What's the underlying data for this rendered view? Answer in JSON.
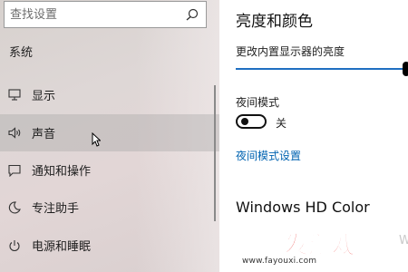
{
  "search": {
    "placeholder": "查找设置",
    "value": ""
  },
  "sidebar": {
    "section_title": "系统",
    "items": [
      {
        "label": "显示",
        "icon": "monitor-icon",
        "active": false
      },
      {
        "label": "声音",
        "icon": "speaker-icon",
        "active": true
      },
      {
        "label": "通知和操作",
        "icon": "notification-icon",
        "active": false
      },
      {
        "label": "专注助手",
        "icon": "moon-icon",
        "active": false
      },
      {
        "label": "电源和睡眠",
        "icon": "power-icon",
        "active": false
      }
    ]
  },
  "content": {
    "title": "亮度和颜色",
    "brightness_label": "更改内置显示器的亮度",
    "brightness_level_percent": 100,
    "night_mode_label": "夜间模式",
    "night_mode_state": "关",
    "night_mode_settings_link": "夜间模式设置",
    "hd_color_title": "Windows HD Color",
    "partial_text": "W"
  },
  "watermark": {
    "logo_text": "发游戏",
    "url": "www.fayouxi.com"
  },
  "colors": {
    "accent": "#1f6fc1",
    "link": "#0063b1",
    "watermark_red": "#e8312f"
  }
}
